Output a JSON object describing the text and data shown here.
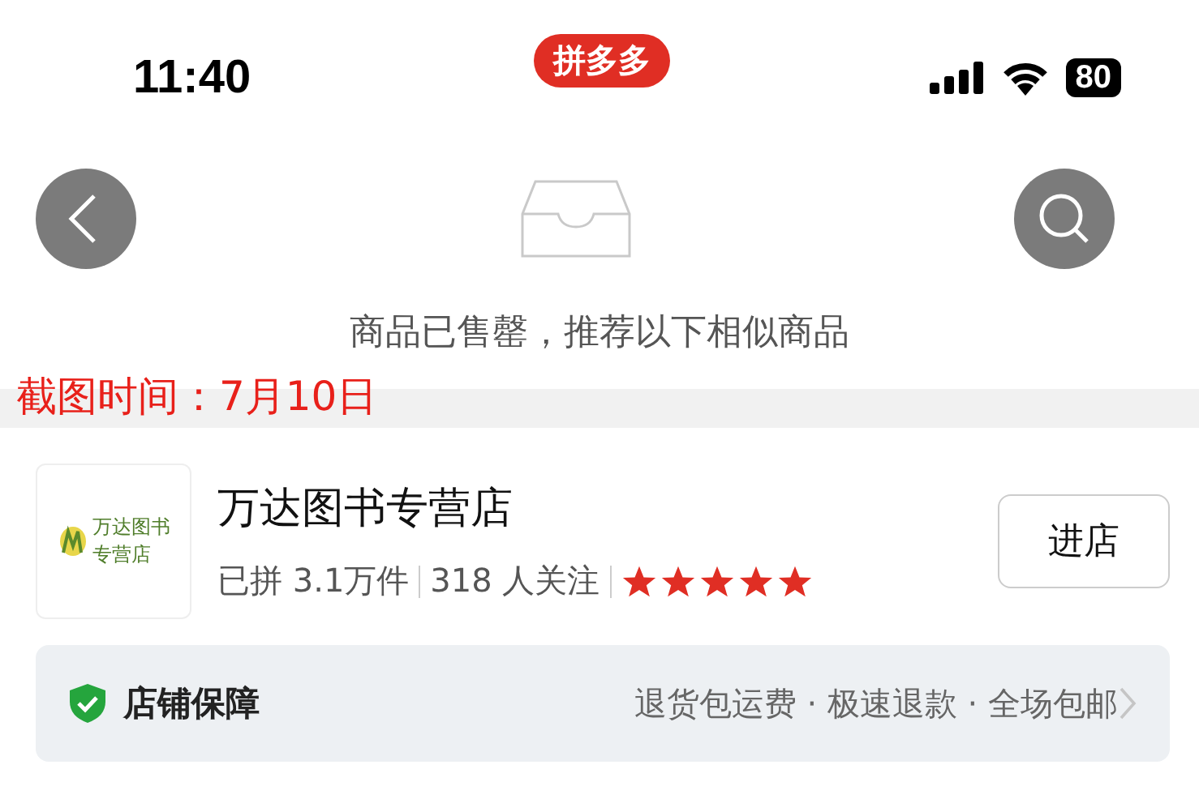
{
  "status_bar": {
    "time": "11:40",
    "app_badge": "拼多多",
    "battery": "80"
  },
  "notice": {
    "message": "商品已售罄，推荐以下相似商品"
  },
  "annotation": "截图时间：7月10日",
  "shop": {
    "logo_lines": [
      "万达图书",
      "专营店"
    ],
    "name": "万达图书专营店",
    "sold": "已拼 3.1万件",
    "followers": "318 人关注",
    "stars": 5,
    "enter_button": "进店"
  },
  "guarantee": {
    "title": "店铺保障",
    "details": "退货包运费 · 极速退款 · 全场包邮"
  }
}
